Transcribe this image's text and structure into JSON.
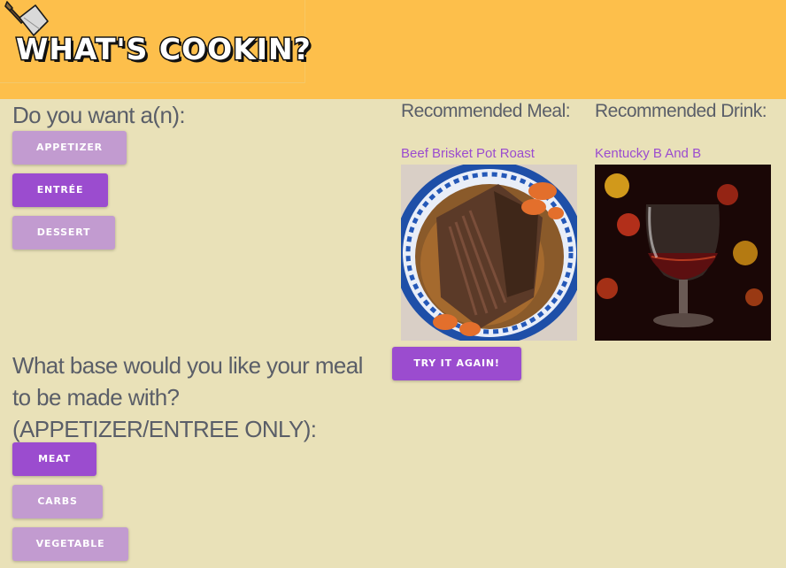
{
  "header": {
    "logo_text": "WHAT'S COOKIN?",
    "background_color": "#fdbf4b",
    "logo_icon": "cleaver-icon"
  },
  "course_question": {
    "text": "Do you want a(n):",
    "options": [
      {
        "label": "APPETIZER",
        "selected": false
      },
      {
        "label": "ENTRÉE",
        "selected": true
      },
      {
        "label": "DESSERT",
        "selected": false
      }
    ]
  },
  "base_question": {
    "line1": "What base would you like your meal",
    "line2": "to be made with?",
    "line3": "(APPETIZER/ENTREE ONLY):",
    "options": [
      {
        "label": "MEAT",
        "selected": true
      },
      {
        "label": "CARBS",
        "selected": false
      },
      {
        "label": "VEGETABLE",
        "selected": false
      }
    ]
  },
  "recommendation": {
    "meal_heading": "Recommended Meal:",
    "meal_name": "Beef Brisket Pot Roast",
    "drink_heading": "Recommended Drink:",
    "drink_name": "Kentucky B And B",
    "retry_label": "TRY IT AGAIN!"
  },
  "colors": {
    "page_background": "#e9e1b8",
    "button_selected": "#9b4ccf",
    "button_unselected": "#c29bd0",
    "link_color": "#9b4ccf",
    "question_text": "#5a5e68"
  }
}
